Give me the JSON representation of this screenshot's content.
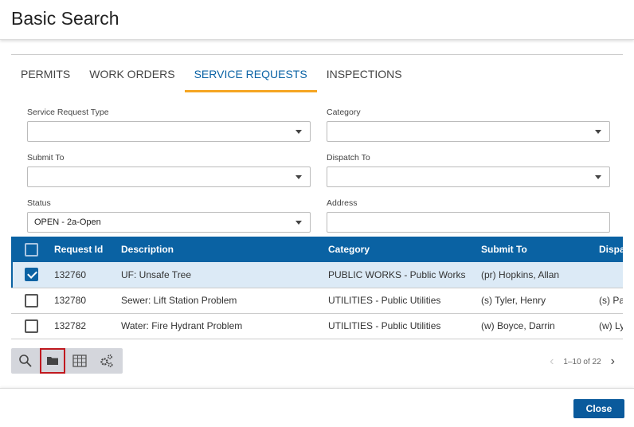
{
  "title": "Basic Search",
  "tabs": [
    {
      "label": "PERMITS"
    },
    {
      "label": "WORK ORDERS"
    },
    {
      "label": "SERVICE REQUESTS",
      "active": true
    },
    {
      "label": "INSPECTIONS"
    }
  ],
  "form": {
    "service_request_type": {
      "label": "Service Request Type",
      "value": ""
    },
    "category": {
      "label": "Category",
      "value": ""
    },
    "submit_to": {
      "label": "Submit To",
      "value": ""
    },
    "dispatch_to": {
      "label": "Dispatch To",
      "value": ""
    },
    "status": {
      "label": "Status",
      "value": "OPEN - 2a-Open"
    },
    "address": {
      "label": "Address",
      "value": ""
    }
  },
  "table": {
    "columns": [
      "Request Id",
      "Description",
      "Category",
      "Submit To",
      "Dispatch To"
    ],
    "rows": [
      {
        "checked": true,
        "id": "132760",
        "description": "UF: Unsafe Tree",
        "category": "PUBLIC WORKS - Public Works",
        "submit_to": "(pr) Hopkins, Allan",
        "dispatch_to": ""
      },
      {
        "checked": false,
        "id": "132780",
        "description": "Sewer: Lift Station Problem",
        "category": "UTILITIES - Public Utilities",
        "submit_to": "(s) Tyler, Henry",
        "dispatch_to": "(s) Pa"
      },
      {
        "checked": false,
        "id": "132782",
        "description": "Water: Fire Hydrant Problem",
        "category": "UTILITIES - Public Utilities",
        "submit_to": "(w) Boyce, Darrin",
        "dispatch_to": "(w) Ly"
      }
    ]
  },
  "toolbar": [
    "search-icon",
    "folder-icon",
    "grid-icon",
    "gears-icon"
  ],
  "pager": {
    "text": "1–10 of 22"
  },
  "close_label": "Close",
  "colors": {
    "accent": "#0a62a3",
    "tab_underline": "#f5a623",
    "highlight": "#c0191f"
  }
}
